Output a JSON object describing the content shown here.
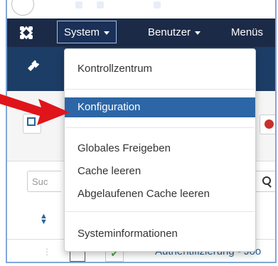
{
  "navbar": {
    "system_label": "System",
    "benutzer_label": "Benutzer",
    "menus_label": "Menüs"
  },
  "dropdown": {
    "items": [
      {
        "label": "Kontrollzentrum"
      },
      {
        "label": "Konfiguration",
        "active": true
      },
      {
        "label": "Globales Freigeben"
      },
      {
        "label": "Cache leeren"
      },
      {
        "label": "Abgelaufenen Cache leeren"
      },
      {
        "label": "Systeminformationen"
      }
    ]
  },
  "search": {
    "placeholder": "Suc"
  },
  "list": {
    "row_title": "Authentifizierung - Joo"
  },
  "colors": {
    "navbar": "#1b2a47",
    "header": "#1c3d66",
    "active_item": "#2d66a6",
    "arrow": "#e0141b",
    "frame_border": "#7fa8d8"
  },
  "icons": {
    "logo": "joomla-logo-icon",
    "header": "plug-icon",
    "arrow": "red-arrow-annotation"
  }
}
